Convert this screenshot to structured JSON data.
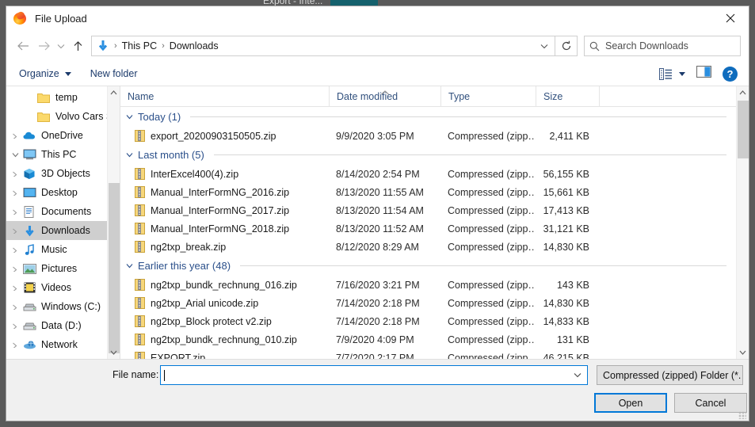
{
  "window": {
    "title": "File Upload",
    "app_icon": "firefox-icon",
    "close_label": "✕",
    "behind_text": "Export - Inte..."
  },
  "nav": {
    "back_icon": "arrow-left-icon",
    "forward_icon": "arrow-right-icon",
    "recent_icon": "chevron-down-icon",
    "up_icon": "arrow-up-icon",
    "breadcrumb": {
      "location_icon": "downloads-icon",
      "parts": [
        "This PC",
        "Downloads"
      ],
      "separator": "›"
    },
    "address_chevron": "chevron-down-icon",
    "refresh_icon": "refresh-icon",
    "search": {
      "icon": "search-icon",
      "placeholder": "Search Downloads",
      "value": ""
    }
  },
  "commandbar": {
    "organize_label": "Organize",
    "organize_caret": "caret-down-icon",
    "new_folder_label": "New folder",
    "view_options_icon": "view-options-icon",
    "view_caret": "caret-down-icon",
    "preview_pane_icon": "preview-pane-icon",
    "help_icon": "help-icon",
    "help_label": "?"
  },
  "sidebar": {
    "items": [
      {
        "label": "temp",
        "icon": "folder-icon",
        "indent": 2,
        "expander": "",
        "selected": false
      },
      {
        "label": "Volvo Cars Sverig",
        "icon": "folder-icon",
        "indent": 2,
        "expander": "",
        "selected": false
      },
      {
        "label": "OneDrive",
        "icon": "onedrive-icon",
        "indent": 0,
        "expander": "chevron-right-icon",
        "selected": false
      },
      {
        "label": "This PC",
        "icon": "thispc-icon",
        "indent": 0,
        "expander": "chevron-down-icon",
        "selected": false
      },
      {
        "label": "3D Objects",
        "icon": "3dobjects-icon",
        "indent": 1,
        "expander": "chevron-right-icon",
        "selected": false
      },
      {
        "label": "Desktop",
        "icon": "desktop-icon",
        "indent": 1,
        "expander": "chevron-right-icon",
        "selected": false
      },
      {
        "label": "Documents",
        "icon": "documents-icon",
        "indent": 1,
        "expander": "chevron-right-icon",
        "selected": false
      },
      {
        "label": "Downloads",
        "icon": "downloads-icon",
        "indent": 1,
        "expander": "chevron-right-icon",
        "selected": true
      },
      {
        "label": "Music",
        "icon": "music-icon",
        "indent": 1,
        "expander": "chevron-right-icon",
        "selected": false
      },
      {
        "label": "Pictures",
        "icon": "pictures-icon",
        "indent": 1,
        "expander": "chevron-right-icon",
        "selected": false
      },
      {
        "label": "Videos",
        "icon": "videos-icon",
        "indent": 1,
        "expander": "chevron-right-icon",
        "selected": false
      },
      {
        "label": "Windows (C:)",
        "icon": "drive-icon",
        "indent": 1,
        "expander": "chevron-right-icon",
        "selected": false
      },
      {
        "label": "Data (D:)",
        "icon": "drive-icon",
        "indent": 1,
        "expander": "chevron-right-icon",
        "selected": false
      },
      {
        "label": "Network",
        "icon": "network-icon",
        "indent": 0,
        "expander": "chevron-right-icon",
        "selected": false
      }
    ],
    "scroll_up_icon": "chevron-up-icon",
    "scroll_down_icon": "chevron-down-icon"
  },
  "filelist": {
    "columns": [
      {
        "label": "Name",
        "sorted": false
      },
      {
        "label": "Date modified",
        "sorted": true
      },
      {
        "label": "Type",
        "sorted": false
      },
      {
        "label": "Size",
        "sorted": false
      }
    ],
    "sort_indicator_icon": "chevron-up-icon",
    "groups": [
      {
        "label": "Today (1)",
        "chevron": "chevron-down-icon",
        "files": [
          {
            "name": "export_20200903150505.zip",
            "icon": "zip-file-icon",
            "date": "9/9/2020 3:05 PM",
            "type": "Compressed (zipp…",
            "size": "2,411 KB"
          }
        ]
      },
      {
        "label": "Last month (5)",
        "chevron": "chevron-down-icon",
        "files": [
          {
            "name": "InterExcel400(4).zip",
            "icon": "zip-file-icon",
            "date": "8/14/2020 2:54 PM",
            "type": "Compressed (zipp…",
            "size": "56,155 KB"
          },
          {
            "name": "Manual_InterFormNG_2016.zip",
            "icon": "zip-file-icon",
            "date": "8/13/2020 11:55 AM",
            "type": "Compressed (zipp…",
            "size": "15,661 KB"
          },
          {
            "name": "Manual_InterFormNG_2017.zip",
            "icon": "zip-file-icon",
            "date": "8/13/2020 11:54 AM",
            "type": "Compressed (zipp…",
            "size": "17,413 KB"
          },
          {
            "name": "Manual_InterFormNG_2018.zip",
            "icon": "zip-file-icon",
            "date": "8/13/2020 11:52 AM",
            "type": "Compressed (zipp…",
            "size": "31,121 KB"
          },
          {
            "name": "ng2txp_break.zip",
            "icon": "zip-file-icon",
            "date": "8/12/2020 8:29 AM",
            "type": "Compressed (zipp…",
            "size": "14,830 KB"
          }
        ]
      },
      {
        "label": "Earlier this year (48)",
        "chevron": "chevron-down-icon",
        "files": [
          {
            "name": "ng2txp_bundk_rechnung_016.zip",
            "icon": "zip-file-icon",
            "date": "7/16/2020 3:21 PM",
            "type": "Compressed (zipp…",
            "size": "143 KB"
          },
          {
            "name": "ng2txp_Arial unicode.zip",
            "icon": "zip-file-icon",
            "date": "7/14/2020 2:18 PM",
            "type": "Compressed (zipp…",
            "size": "14,830 KB"
          },
          {
            "name": "ng2txp_Block protect v2.zip",
            "icon": "zip-file-icon",
            "date": "7/14/2020 2:18 PM",
            "type": "Compressed (zipp…",
            "size": "14,833 KB"
          },
          {
            "name": "ng2txp_bundk_rechnung_010.zip",
            "icon": "zip-file-icon",
            "date": "7/9/2020 4:09 PM",
            "type": "Compressed (zipp…",
            "size": "131 KB"
          },
          {
            "name": "EXPORT.zip",
            "icon": "zip-file-icon",
            "date": "7/7/2020 2:17 PM",
            "type": "Compressed (zipp…",
            "size": "46,215 KB"
          }
        ]
      }
    ],
    "scroll_up_icon": "chevron-up-icon",
    "scroll_down_icon": "chevron-down-icon"
  },
  "footer": {
    "filename_label": "File name:",
    "filename_value": "",
    "filename_chevron": "chevron-down-icon",
    "filter_value": "Compressed (zipped) Folder (*.",
    "filter_chevron": "chevron-down-icon",
    "open_label": "Open",
    "cancel_label": "Cancel"
  },
  "colors": {
    "accent": "#0078d7",
    "group_header": "#2a4f8a",
    "column_header": "#31507d",
    "selection": "#cfcfcf"
  }
}
